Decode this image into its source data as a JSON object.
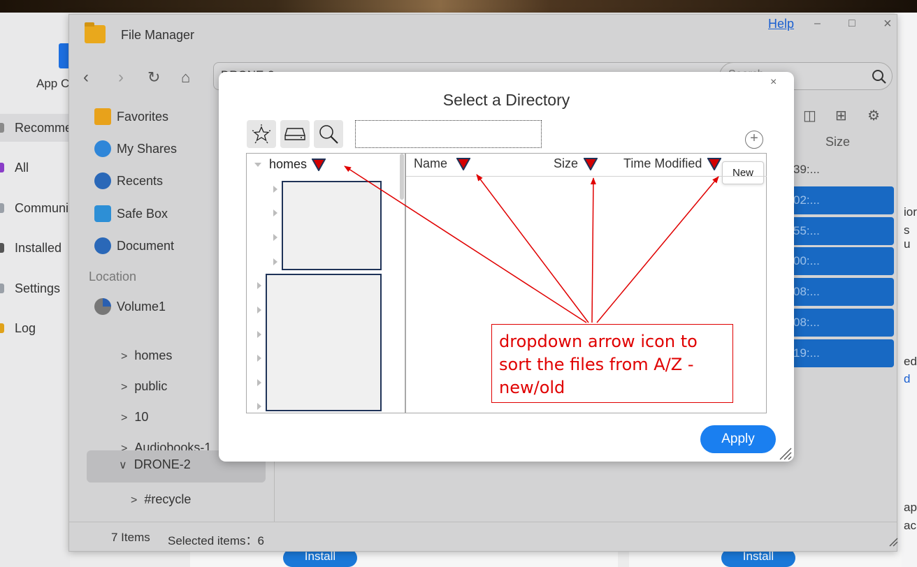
{
  "colors": {
    "accent": "#1a7ff0",
    "annotation": "#e00000",
    "sort_arrow_fill": "#d40000",
    "sort_arrow_stroke": "#1f3358",
    "mask_border": "#1f3358",
    "folder": "#e9a81c",
    "row_highlight": "#1869c3"
  },
  "app_center": {
    "title": "App C",
    "nav": [
      {
        "label": "Recomme",
        "active": true
      },
      {
        "label": "All"
      },
      {
        "label": "Communi"
      },
      {
        "label": "Installed"
      },
      {
        "label": "Settings"
      },
      {
        "label": "Log"
      }
    ],
    "right_fragments": [
      "ior",
      "s u",
      "ed",
      "d",
      "ap",
      "ac"
    ],
    "install_label": "Install"
  },
  "file_manager": {
    "title": "File Manager",
    "help": "Help",
    "controls": {
      "minimize": "–",
      "maximize": "□",
      "close": "×"
    },
    "path": "DRONE-2 >",
    "search_placeholder": "Search",
    "size_header": "Size",
    "times": [
      "39:...",
      "02:...",
      "55:...",
      "00:...",
      "08:...",
      "08:...",
      "19:..."
    ],
    "sidebar": {
      "quick": [
        {
          "label": "Favorites",
          "icon": "star-icon"
        },
        {
          "label": "My Shares",
          "icon": "share-icon"
        },
        {
          "label": "Recents",
          "icon": "clock-icon"
        },
        {
          "label": "Safe Box",
          "icon": "cube-icon"
        },
        {
          "label": "Document",
          "icon": "document-icon"
        }
      ],
      "location_header": "Location",
      "volume": "Volume1",
      "folders": [
        "homes",
        "public",
        "10",
        "Audiobooks-1",
        "DRONE-2",
        "#recycle"
      ]
    },
    "status": {
      "items": "7 Items",
      "selected": "Selected items：6"
    }
  },
  "dialog": {
    "title": "Select a Directory",
    "close": "×",
    "tools": [
      {
        "name": "favorites-tool-button",
        "icon": "star-outline-icon"
      },
      {
        "name": "drive-tool-button",
        "icon": "drive-icon"
      },
      {
        "name": "search-tool-button",
        "icon": "magnifier-icon"
      }
    ],
    "input_value": "",
    "new_tooltip": "New",
    "tree_root": "homes",
    "columns": {
      "name": "Name",
      "size": "Size",
      "modified": "Time Modified"
    },
    "apply": "Apply"
  },
  "annotation": {
    "lines": [
      "dropdown arrow icon to",
      "sort the files from A/Z -",
      "new/old"
    ]
  }
}
